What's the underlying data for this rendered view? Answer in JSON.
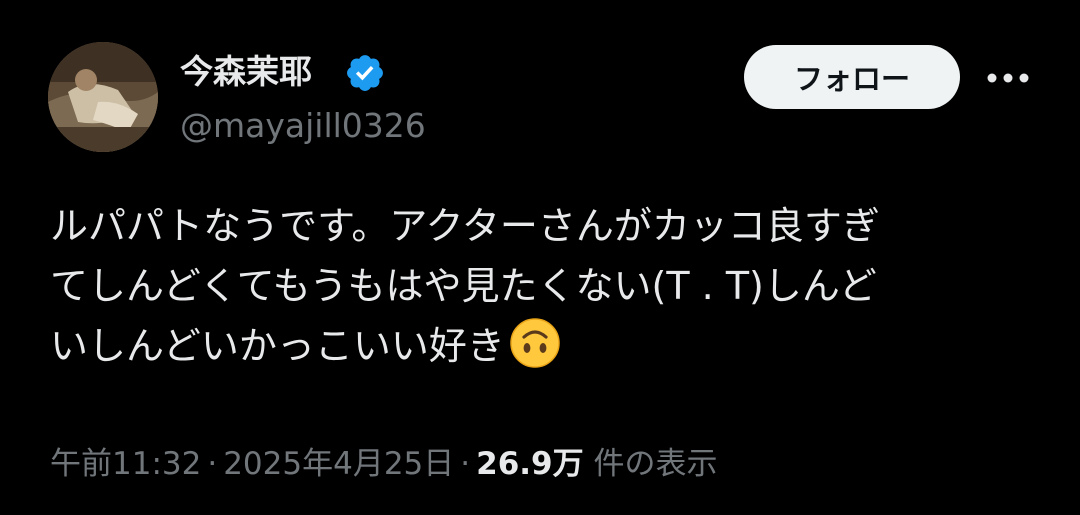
{
  "author": {
    "display_name": "今森茉耶",
    "handle": "@mayajill0326",
    "verified": true,
    "verified_icon": "verified-badge-icon",
    "avatar_icon": "profile-photo"
  },
  "actions": {
    "follow_label": "フォロー",
    "more_icon": "more-dots-icon"
  },
  "tweet": {
    "lines": [
      "ルパパトなうです。アクターさんがカッコ良すぎ",
      "てしんどくてもうもはや見たくない(T . T)しんど",
      "いしんどいかっこいい好き"
    ],
    "emoji": "upside-down-face-emoji"
  },
  "meta": {
    "time": "午前11:32",
    "separator": "·",
    "date": "2025年4月25日",
    "views_count": "26.9万",
    "views_label": "件の表示"
  },
  "colors": {
    "background": "#000000",
    "primary_text": "#e7e9ea",
    "secondary_text": "#71767b",
    "verified_blue": "#1d9bf0",
    "follow_button_bg": "#eff3f4"
  }
}
